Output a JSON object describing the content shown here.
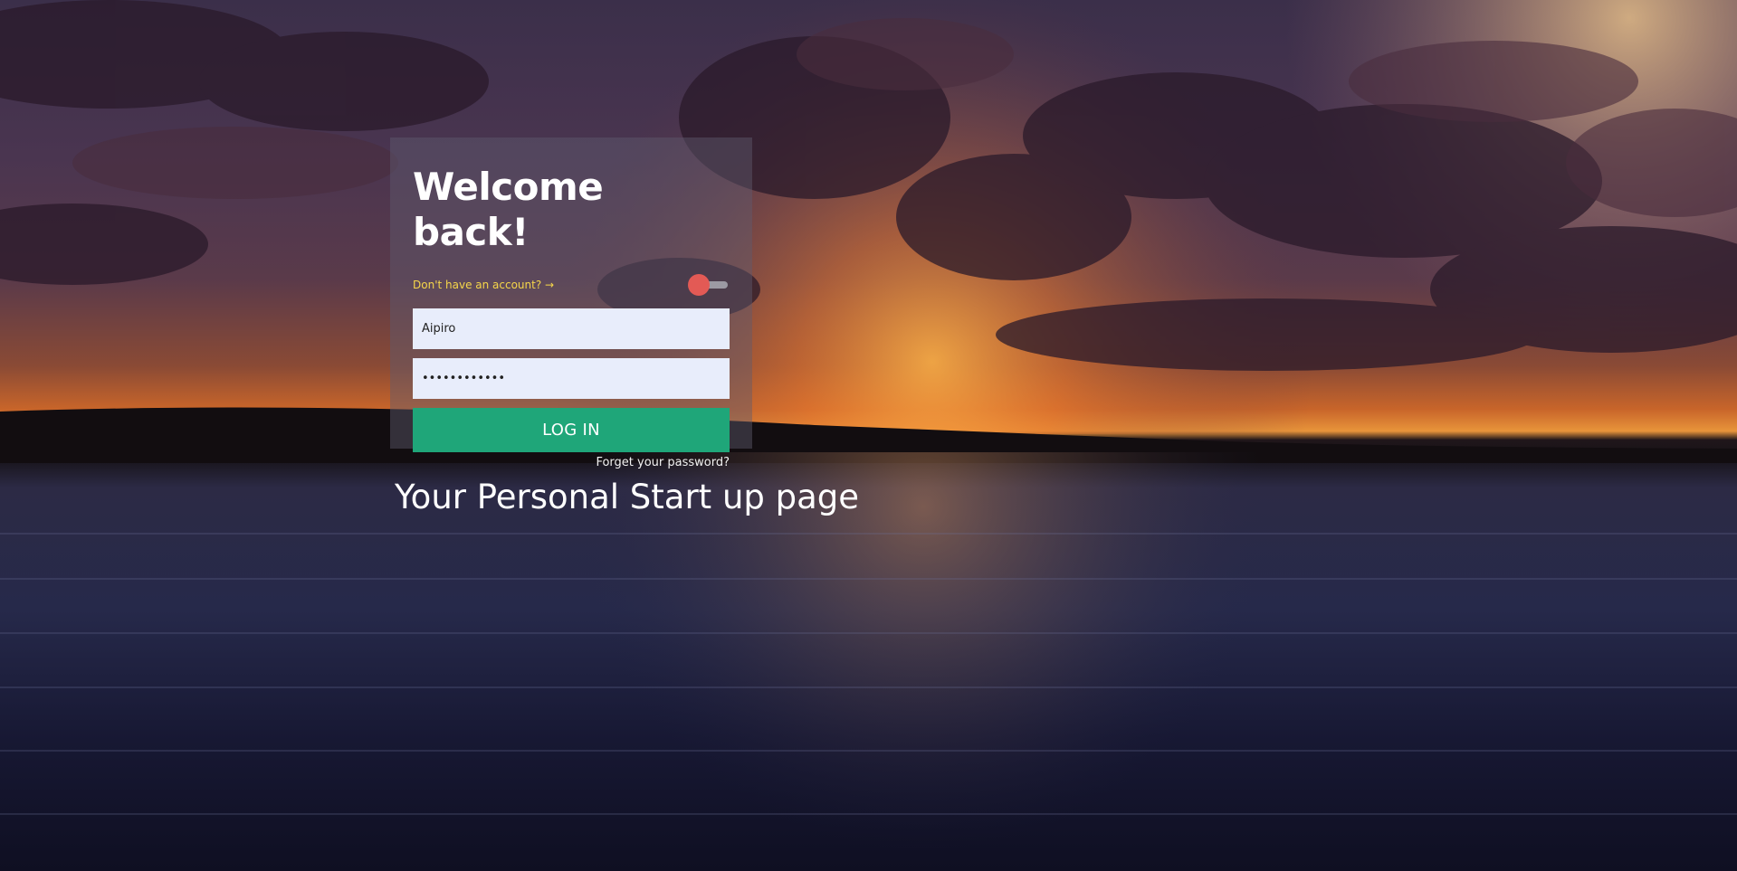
{
  "login": {
    "title": "Welcome back!",
    "signup_link": "Don't have an account? →",
    "toggle_on": false,
    "username_value": "Aipiro",
    "password_value": "••••••••••••",
    "login_button": "LOG IN",
    "forgot_link": "Forget your password?"
  },
  "tagline": "Your Personal Start up page",
  "colors": {
    "card_background": "#5f5c6e",
    "signup_link": "#f6d64a",
    "toggle_knob": "#e35a55",
    "input_background": "#e8edfb",
    "login_button": "#1fa679"
  }
}
